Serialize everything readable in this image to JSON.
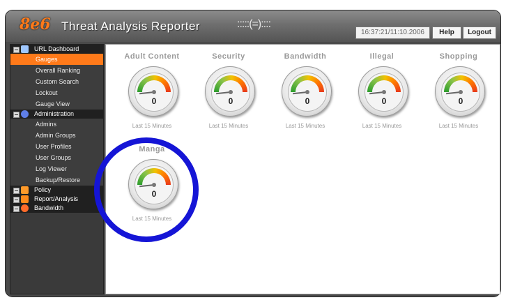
{
  "app": {
    "logo": "8e6",
    "title": "Threat Analysis Reporter",
    "mark": ":::::(=)::::"
  },
  "header": {
    "clock": "16:37:21/11:10.2006",
    "help_label": "Help",
    "logout_label": "Logout"
  },
  "sidebar": {
    "sections": [
      {
        "label": "URL Dashboard",
        "icon_color": "#9fc7ff",
        "items": [
          "Gauges",
          "Overall Ranking",
          "Custom Search",
          "Lockout",
          "Gauge View"
        ]
      },
      {
        "label": "Administration",
        "icon_color": "#5f7fe8",
        "items": [
          "Admins",
          "Admin Groups",
          "User Profiles",
          "User Groups",
          "Log Viewer",
          "Backup/Restore"
        ]
      },
      {
        "label": "Policy",
        "icon_color": "#ff9a2a",
        "items": []
      },
      {
        "label": "Report/Analysis",
        "icon_color": "#ff8a1a",
        "items": []
      },
      {
        "label": "Bandwidth",
        "icon_color": "#ff6b2a",
        "items": []
      }
    ],
    "active_item": "Gauges"
  },
  "gauges": [
    {
      "title": "Adult Content",
      "value": "0",
      "subtitle": "Last 15 Minutes"
    },
    {
      "title": "Security",
      "value": "0",
      "subtitle": "Last 15 Minutes"
    },
    {
      "title": "Bandwidth",
      "value": "0",
      "subtitle": "Last 15 Minutes"
    },
    {
      "title": "Illegal",
      "value": "0",
      "subtitle": "Last 15 Minutes"
    },
    {
      "title": "Shopping",
      "value": "0",
      "subtitle": "Last 15 Minutes"
    },
    {
      "title": "Manga",
      "value": "0",
      "subtitle": "Last 15 Minutes"
    }
  ],
  "colors": {
    "accent": "#ff7a1a",
    "annotation_circle": "#1515d6"
  }
}
